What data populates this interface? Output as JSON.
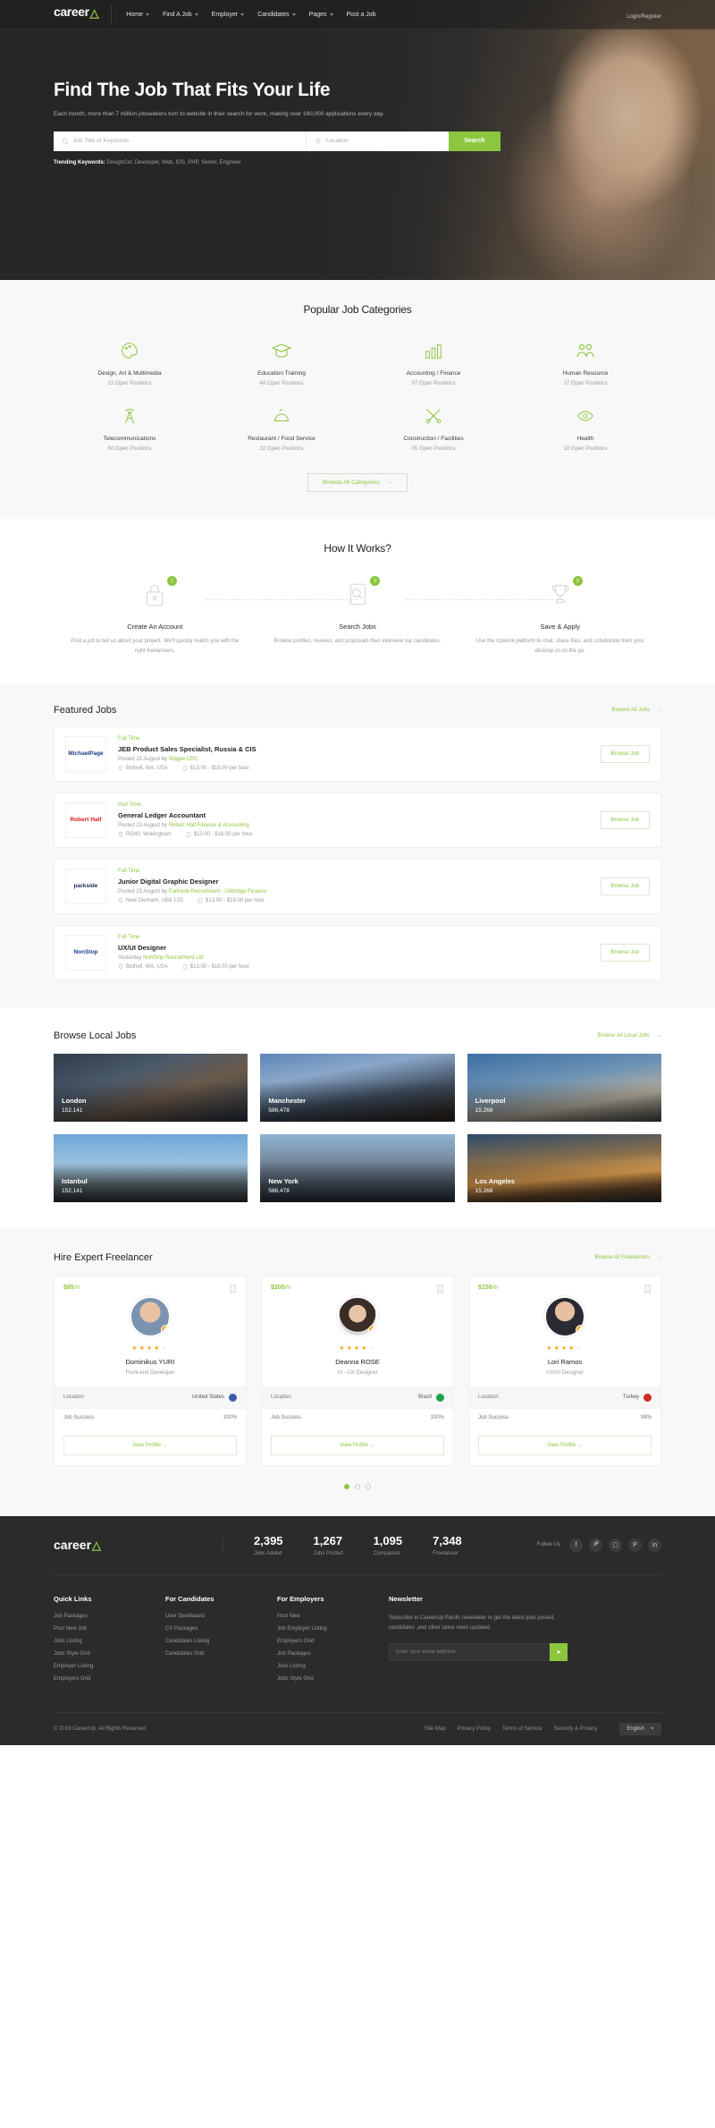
{
  "nav": {
    "logo": "career",
    "logo_icon": "rocket-icon",
    "items": [
      {
        "label": "Home",
        "caret": true
      },
      {
        "label": "Find A Job",
        "caret": true
      },
      {
        "label": "Employer",
        "caret": true
      },
      {
        "label": "Candidates",
        "caret": true
      },
      {
        "label": "Pages",
        "caret": true
      },
      {
        "label": "Post a Job",
        "caret": false
      }
    ],
    "account": "Login/Register"
  },
  "hero": {
    "title": "Find The Job That Fits Your Life",
    "subtitle": "Each month, more than 7 million jobseekers turn to website in their search for work, making over 160,000 applications every day.",
    "keyword_placeholder": "Job Title or Keywords",
    "location_placeholder": "Location",
    "keyword_value": "",
    "location_value": "",
    "search_button": "Search",
    "trending_label": "Trending Keywords:",
    "trending_values": "DesignCer, Developer, Web, IOS, PHP, Senior, Engineer"
  },
  "categories": {
    "title": "Popular Job Categories",
    "browse_all": "Browse All Categories",
    "items": [
      {
        "name": "Design, Art & Multimedia",
        "count": "22 Open Positions",
        "icon": "palette-icon"
      },
      {
        "name": "Education Training",
        "count": "48 Open Positions",
        "icon": "graduation-cap-icon"
      },
      {
        "name": "Accounting / Finance",
        "count": "97 Open Positions",
        "icon": "bar-chart-icon"
      },
      {
        "name": "Human Resource",
        "count": "17 Open Positions",
        "icon": "people-icon"
      },
      {
        "name": "Telecommunications",
        "count": "60 Open Positions",
        "icon": "antenna-tower-icon"
      },
      {
        "name": "Restaurant / Food Service",
        "count": "22 Open Positions",
        "icon": "food-dome-icon"
      },
      {
        "name": "Construction / Facilities",
        "count": "05 Open Positions",
        "icon": "tools-icon"
      },
      {
        "name": "Health",
        "count": "10 Open Positions",
        "icon": "eye-care-icon"
      }
    ]
  },
  "how_it_works": {
    "title": "How It Works?",
    "steps": [
      {
        "num": "1",
        "title": "Create An Account",
        "text": "Post a job to tell us about your project. We'll quickly match you with the right freelancers.",
        "icon": "lock-icon"
      },
      {
        "num": "2",
        "title": "Search Jobs",
        "text": "Browse profiles, reviews, and proposals then interview top candidates.",
        "icon": "search-profile-icon"
      },
      {
        "num": "3",
        "title": "Save & Apply",
        "text": "Use the Upwork platform to chat, share files, and collaborate from your desktop or on the go.",
        "icon": "trophy-icon"
      }
    ]
  },
  "featured_jobs": {
    "title": "Featured Jobs",
    "browse_all": "Browse All Jobs",
    "button_label": "Browse Job",
    "items": [
      {
        "logo": "MichaelPage",
        "logo_color": "#1a3a7a",
        "type": "Full Time",
        "title": "JEB Product Sales Specialist, Russia & CIS",
        "posted_prefix": "Posted 23 August by",
        "company": "Wiggle CRC",
        "location": "Bothell, WA, USA",
        "salary": "$13.00 - $18.00 per hour"
      },
      {
        "logo": "Robert Half",
        "logo_color": "#d21b1b",
        "type": "Part Time",
        "title": "General Ledger Accountant",
        "posted_prefix": "Posted 23 August by",
        "company": "Robert Half Finance & Accounting",
        "location": "RG40, Wokingham",
        "salary": "$13.00 - $18.00 per hour"
      },
      {
        "logo": "parkside",
        "logo_color": "#1b2a4a",
        "type": "Full Time",
        "title": "Junior Digital Graphic Designer",
        "posted_prefix": "Posted 23 August by",
        "company": "Parkside Recruitment - Uxbridge Finance",
        "location": "New Denham, UB8 1JG",
        "salary": "$13.00 - $18.00 per hour"
      },
      {
        "logo": "NonStop",
        "logo_color": "#1b3d8f",
        "type": "Full Time",
        "title": "UX/UI Designer",
        "posted_prefix": "Yesterday",
        "company": "NonStop Recruitment Ltd",
        "location": "Bothell, WA, USA",
        "salary": "$13.00 - $18.00 per hour"
      }
    ]
  },
  "local_jobs": {
    "title": "Browse Local Jobs",
    "browse_all": "Browse All Local Jobs",
    "cities": [
      {
        "name": "London",
        "count": "152,141"
      },
      {
        "name": "Manchester",
        "count": "586,478"
      },
      {
        "name": "Liverpool",
        "count": "15,268"
      },
      {
        "name": "Istanbul",
        "count": "152,141"
      },
      {
        "name": "New York",
        "count": "586,478"
      },
      {
        "name": "Los Angeles",
        "count": "15,268"
      }
    ]
  },
  "freelancers": {
    "title": "Hire Expert Freelancer",
    "browse_all": "Browse All Freelancers",
    "location_label": "Location",
    "success_label": "Job Success",
    "profile_button": "View Profile",
    "items": [
      {
        "rate": "$85",
        "rate_unit": "/hr",
        "name": "Dominikus YURI",
        "role": "Front-end Developer",
        "stars": 4,
        "location": "United States",
        "flag_color": "#3c5ca8",
        "success": "100%"
      },
      {
        "rate": "$200",
        "rate_unit": "/hr",
        "name": "Deanna ROSE",
        "role": "UI - UX Designer",
        "stars": 4,
        "location": "Brazil",
        "flag_color": "#1ba64a",
        "success": "100%"
      },
      {
        "rate": "$150",
        "rate_unit": "/hr",
        "name": "Lori Ramos",
        "role": "UX/UI Designer",
        "stars": 4,
        "location": "Turkey",
        "flag_color": "#d42a2a",
        "success": "98%"
      }
    ],
    "dots": 3
  },
  "footer": {
    "logo": "career",
    "stats": [
      {
        "num": "2,395",
        "label": "Jobs Added"
      },
      {
        "num": "1,267",
        "label": "Jobs Posted"
      },
      {
        "num": "1,095",
        "label": "Companies"
      },
      {
        "num": "7,348",
        "label": "Freelancer"
      }
    ],
    "follow_label": "Follow Us",
    "socials": [
      "facebook-icon",
      "twitter-icon",
      "instagram-icon",
      "pinterest-icon",
      "linkedin-icon"
    ],
    "columns": [
      {
        "title": "Quick Links",
        "links": [
          "Job Packages",
          "Post New Job",
          "Jobs Listing",
          "Jobs Style Grid",
          "Employer Listing",
          "Employers Grid"
        ]
      },
      {
        "title": "For Candidates",
        "links": [
          "User Dashboard",
          "CV Packages",
          "Candidates Listing",
          "Candidates Grid"
        ]
      },
      {
        "title": "For Employers",
        "links": [
          "Post New",
          "Job Employer Listing",
          "Employers Grid",
          "Job Packages",
          "Jobs Listing",
          "Jobs Style Grid"
        ]
      }
    ],
    "newsletter": {
      "title": "Newsletter",
      "text": "Subscribe to CareerUp Pacific newsletter to get the latest jobs posted, candidates ,and other latest news updated.",
      "placeholder": "Enter your email address",
      "button_icon": "send-icon"
    },
    "copyright": "© 2019 CareerUp. All Rights Reserved",
    "bottom_links": [
      "Site Map",
      "Privacy Policy",
      "Terms of Service",
      "Security & Privacy"
    ],
    "language": "English"
  }
}
